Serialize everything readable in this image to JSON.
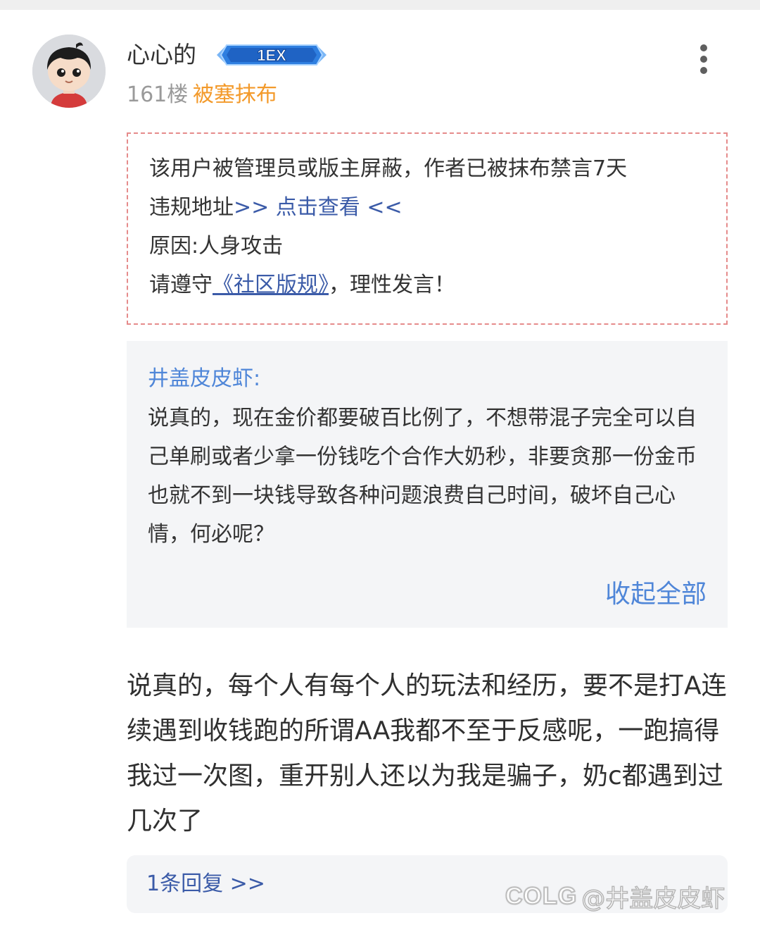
{
  "post": {
    "username": "心心的",
    "level_badge": "1EX",
    "floor": "161楼",
    "penalty_tag": "被塞抹布",
    "more_icon": "more-vertical-icon"
  },
  "notice": {
    "line1": "该用户被管理员或版主屏蔽，作者已被抹布禁言7天",
    "line2_prefix": "违规地址",
    "line2_link": ">> 点击查看 <<",
    "line3": "原因:人身攻击",
    "line4_prefix": "请遵守",
    "line4_link": "《社区版规》",
    "line4_suffix": "，理性发言！"
  },
  "quote": {
    "author": "井盖皮皮虾:",
    "body": "说真的，现在金价都要破百比例了，不想带混子完全可以自己单刷或者少拿一份钱吃个合作大奶秒，非要贪那一份金币也就不到一块钱导致各种问题浪费自己时间，破坏自己心情，何必呢？",
    "collapse_label": "收起全部"
  },
  "content": {
    "text": "说真的，每个人有每个人的玩法和经历，要不是打A连续遇到收钱跑的所谓AA我都不至于反感呢，一跑搞得我过一次图，重开别人还以为我是骗子，奶c都遇到过几次了"
  },
  "replies": {
    "label": "1条回复 >>"
  },
  "watermark": {
    "logo": "COLG",
    "handle": "@井盖皮皮虾"
  },
  "colors": {
    "accent_blue": "#4f86d8",
    "link_blue": "#3b5ba8",
    "penalty_orange": "#f39a2b",
    "notice_border": "#e58b8b"
  }
}
